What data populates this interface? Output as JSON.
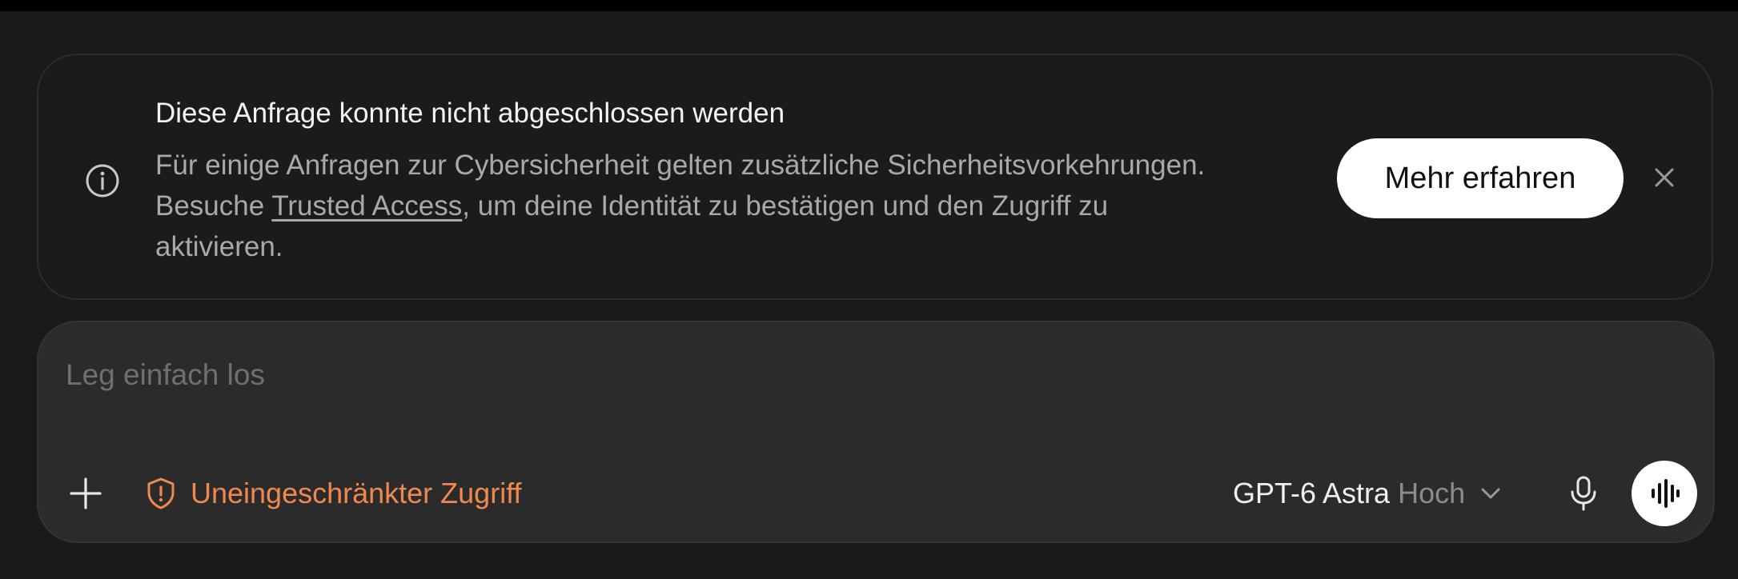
{
  "notice": {
    "icon": "info-icon",
    "title": "Diese Anfrage konnte nicht abgeschlossen werden",
    "body_before_link": "Für einige Anfragen zur Cybersicherheit gelten zusätzliche Sicherheitsvorkehrungen. Besuche ",
    "link_text": "Trusted Access",
    "body_after_link": ", um deine Identität zu bestätigen und den Zugriff zu aktivieren.",
    "learn_more_label": "Mehr erfahren",
    "close_icon": "close-icon"
  },
  "composer": {
    "placeholder": "Leg einfach los",
    "value": "",
    "add_icon": "plus-icon",
    "access_icon": "shield-alert-icon",
    "access_label": "Uneingeschränkter Zugriff",
    "model_name": "GPT-6 Astra",
    "model_effort": "Hoch",
    "model_dropdown_icon": "chevron-down-icon",
    "dictate_icon": "microphone-icon",
    "voice_icon": "voice-waveform-icon"
  },
  "colors": {
    "background": "#1a1a1a",
    "top_bar": "#000000",
    "notice_background": "#1b1b1b",
    "composer_background": "#2b2b2b",
    "primary_text": "#f3f3f3",
    "secondary_text": "#a9a9a9",
    "placeholder_text": "#6f6f6f",
    "warning_accent": "#f0894f",
    "button_background": "#ffffff"
  }
}
